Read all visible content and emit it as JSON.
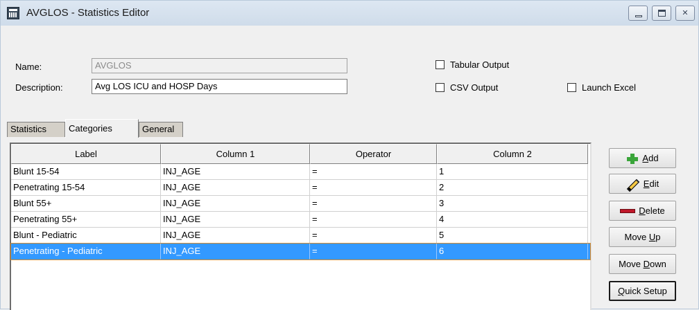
{
  "window": {
    "title": "AVGLOS - Statistics Editor"
  },
  "form": {
    "name_label": "Name:",
    "name_value": "AVGLOS",
    "description_label": "Description:",
    "description_value": "Avg LOS ICU and HOSP Days"
  },
  "options": {
    "tabular_output": {
      "label": "Tabular Output",
      "checked": false
    },
    "csv_output": {
      "label": "CSV Output",
      "checked": false
    },
    "launch_excel": {
      "label": "Launch Excel",
      "checked": false
    }
  },
  "tabs": [
    {
      "label": "Statistics",
      "active": false
    },
    {
      "label": "Categories",
      "active": true
    },
    {
      "label": "General",
      "active": false
    }
  ],
  "grid": {
    "columns": [
      "Label",
      "Column 1",
      "Operator",
      "Column 2"
    ],
    "rows": [
      [
        "Blunt 15-54",
        "INJ_AGE",
        "=",
        "1"
      ],
      [
        "Penetrating 15-54",
        "INJ_AGE",
        "=",
        "2"
      ],
      [
        "Blunt 55+",
        "INJ_AGE",
        "=",
        "3"
      ],
      [
        "Penetrating 55+",
        "INJ_AGE",
        "=",
        "4"
      ],
      [
        "Blunt - Pediatric",
        "INJ_AGE",
        "=",
        "5"
      ],
      [
        "Penetrating - Pediatric",
        "INJ_AGE",
        "=",
        "6"
      ]
    ],
    "selected_row": 5
  },
  "buttons": {
    "add": {
      "pre": "",
      "key": "A",
      "post": "dd"
    },
    "edit": {
      "pre": "",
      "key": "E",
      "post": "dit"
    },
    "delete": {
      "pre": "",
      "key": "D",
      "post": "elete"
    },
    "move_up": {
      "pre": "Move ",
      "key": "U",
      "post": "p"
    },
    "move_down": {
      "pre": "Move ",
      "key": "D",
      "post": "own"
    },
    "quick_setup": {
      "pre": "",
      "key": "Q",
      "post": "uick Setup"
    }
  },
  "colors": {
    "selection": "#3399ff",
    "add_icon": "#3aa53a",
    "delete_icon": "#c0182a"
  }
}
